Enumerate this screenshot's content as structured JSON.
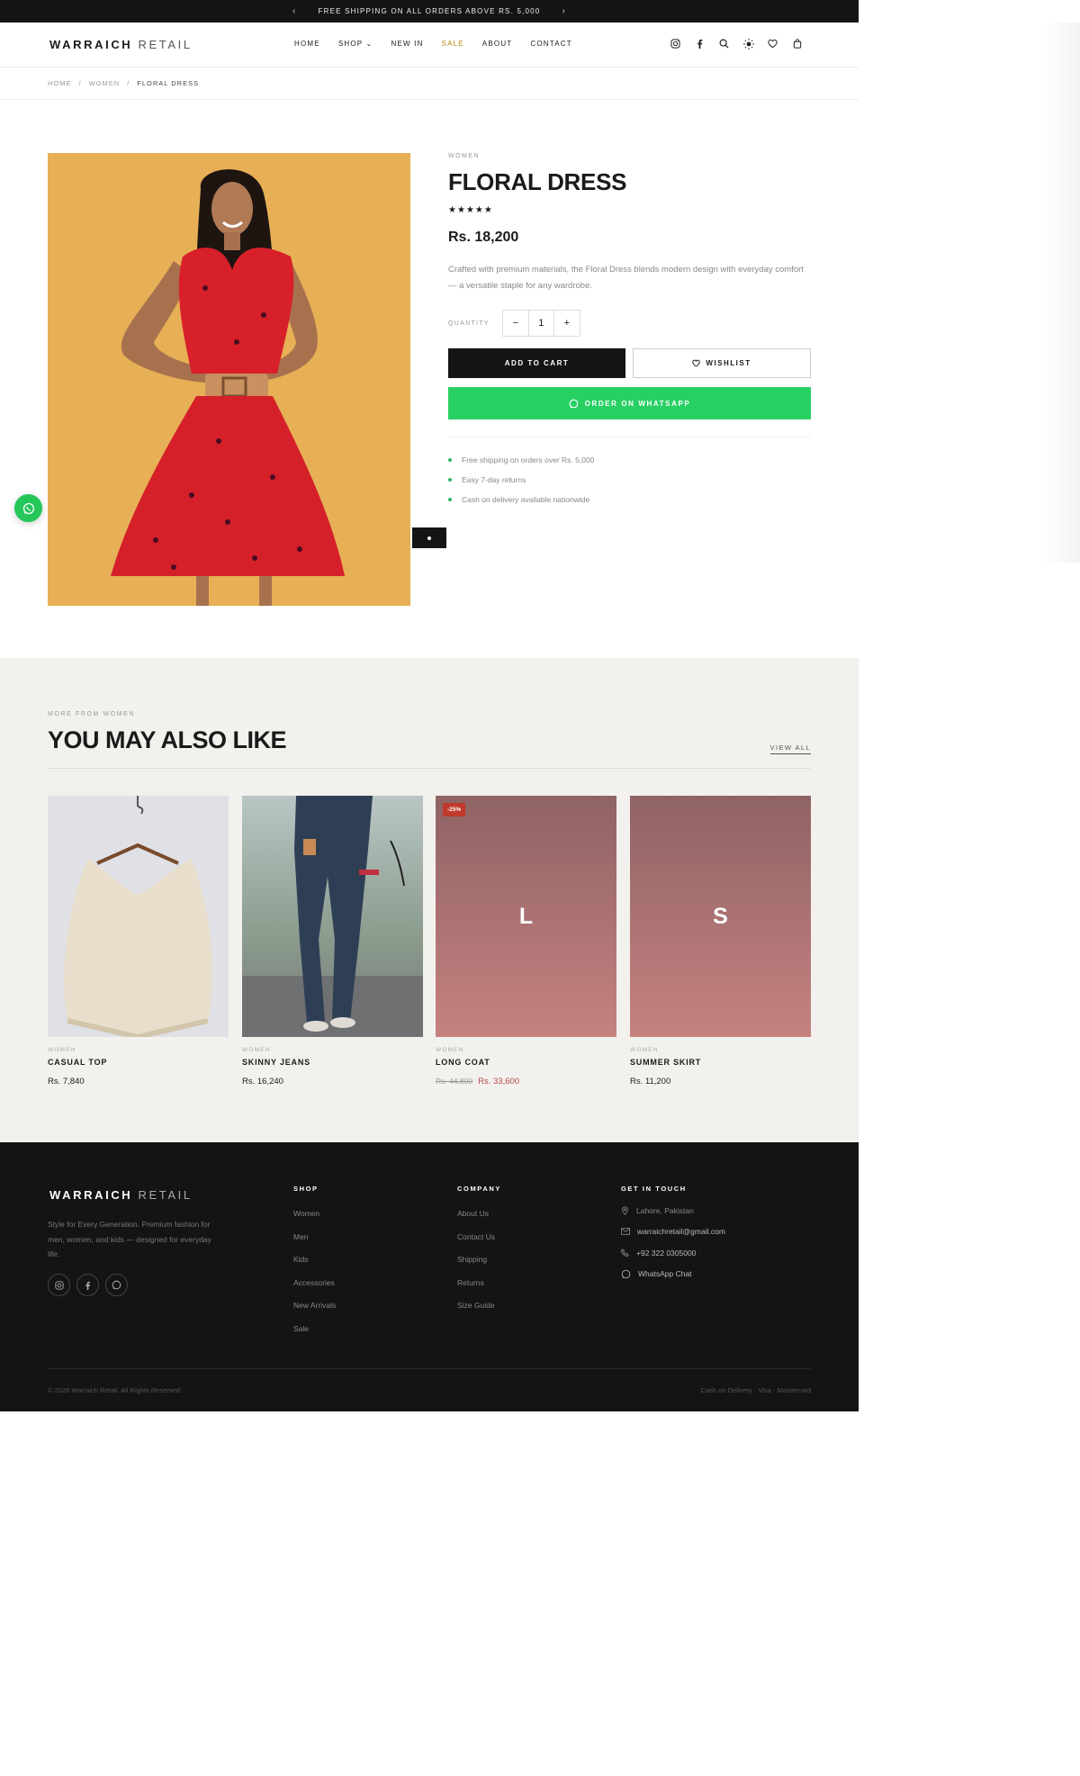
{
  "announcement": {
    "text": "FREE SHIPPING ON ALL ORDERS ABOVE RS. 5,000",
    "prev": "‹",
    "next": "›"
  },
  "brand": {
    "bold": "WARRAICH",
    "thin": "RETAIL"
  },
  "nav": {
    "home": "HOME",
    "shop": "SHOP ⌄",
    "new_in": "NEW IN",
    "sale": "SALE",
    "about": "ABOUT",
    "contact": "CONTACT"
  },
  "breadcrumb": {
    "home": "HOME",
    "sep": "/",
    "women": "WOMEN",
    "current": "FLORAL DRESS"
  },
  "product": {
    "category": "WOMEN",
    "title": "FLORAL DRESS",
    "rating_stars": "★★★★★",
    "price": "Rs. 18,200",
    "description": "Crafted with premium materials, the Floral Dress blends modern design with everyday comfort — a versatile staple for any wardrobe.",
    "quantity_label": "QUANTITY",
    "quantity": "1",
    "minus": "−",
    "plus": "+",
    "add_to_cart": "ADD TO CART",
    "wishlist": "WISHLIST",
    "order_whatsapp": "ORDER ON WHATSAPP",
    "perks": [
      "Free shipping on orders over Rs. 5,000",
      "Easy 7-day returns",
      "Cash on delivery available nationwide"
    ]
  },
  "related": {
    "subtitle": "MORE FROM WOMEN",
    "title": "YOU MAY ALSO LIKE",
    "view_all": "VIEW ALL",
    "items": [
      {
        "category": "WOMEN",
        "name": "CASUAL TOP",
        "price": "Rs. 7,840"
      },
      {
        "category": "WOMEN",
        "name": "SKINNY JEANS",
        "price": "Rs. 16,240"
      },
      {
        "category": "WOMEN",
        "name": "LONG COAT",
        "old_price": "Rs. 44,800",
        "price": "Rs. 33,600",
        "badge": "-25%",
        "placeholder_letter": "L"
      },
      {
        "category": "WOMEN",
        "name": "SUMMER SKIRT",
        "price": "Rs. 11,200",
        "placeholder_letter": "S"
      }
    ]
  },
  "footer": {
    "tagline": "Style for Every Generation. Premium fashion for men, women, and kids — designed for everyday life.",
    "shop_heading": "SHOP",
    "shop_links": [
      "Women",
      "Men",
      "Kids",
      "Accessories",
      "New Arrivals",
      "Sale"
    ],
    "company_heading": "COMPANY",
    "company_links": [
      "About Us",
      "Contact Us",
      "Shipping",
      "Returns",
      "Size Guide"
    ],
    "contact_heading": "GET IN TOUCH",
    "location": "Lahore, Pakistan",
    "email": "warraichretail@gmail.com",
    "phone": "+92 322 0305000",
    "whatsapp": "WhatsApp Chat",
    "copyright": "© 2026 Warraich Retail. All Rights Reserved.",
    "payments": "Cash on Delivery · Visa · Mastercard"
  },
  "colors": {
    "dark": "#141414",
    "whatsapp": "#28d064",
    "sale": "#b8860b",
    "discount": "#b5474b"
  }
}
